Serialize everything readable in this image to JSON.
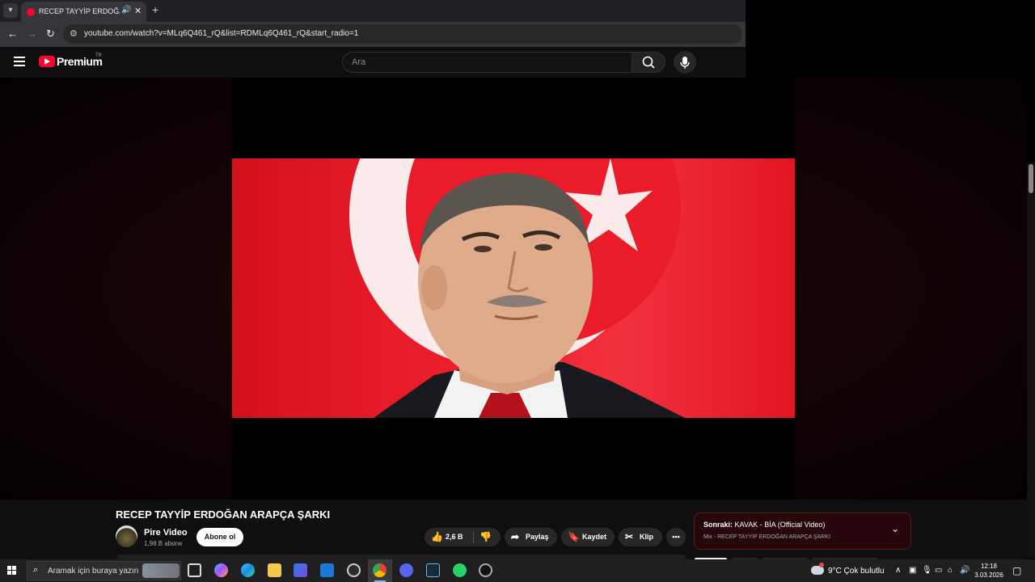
{
  "browser": {
    "tab_title": "RECEP TAYYİP ERDOĞAN AR",
    "url": "youtube.com/watch?v=MLq6Q461_rQ&list=RDMLq6Q461_rQ&start_radio=1"
  },
  "header": {
    "logo_text": "Premium",
    "country_code": "TR",
    "search_placeholder": "Ara"
  },
  "video": {
    "title": "RECEP TAYYİP ERDOĞAN ARAPÇA ŞARKI",
    "channel_name": "Pire Video",
    "subscribers": "1,98 B abone",
    "subscribe_label": "Abone ol",
    "likes": "2,6 B",
    "share_label": "Paylaş",
    "save_label": "Kaydet",
    "clip_label": "Klip"
  },
  "up_next": {
    "prefix": "Sonraki:",
    "title": "KAVAK - BİA (Official Video)",
    "subtitle": "Mix - RECEP TAYYİP ERDOĞAN ARAPÇA ŞARKI"
  },
  "taskbar": {
    "search_text": "Aramak için buraya yazın",
    "weather": "9°C  Çok bulutlu",
    "time": "12:18",
    "date": "3.03.2026"
  },
  "colors": {
    "youtube_red": "#ff0033",
    "flag_red": "#e30a17",
    "chrome_dark": "#202124"
  }
}
